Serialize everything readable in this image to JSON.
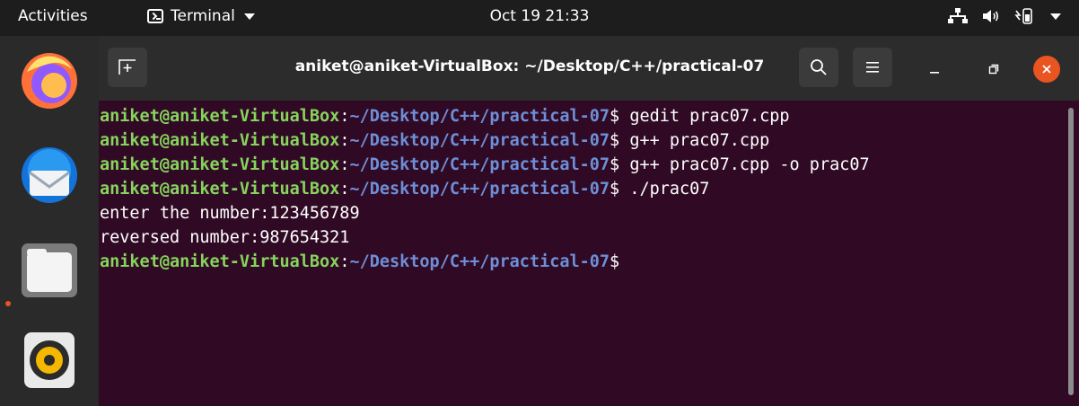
{
  "topbar": {
    "activities": "Activities",
    "app_name": "Terminal",
    "clock": "Oct 19  21:33"
  },
  "dock": {
    "items": [
      "firefox-icon",
      "thunderbird-icon",
      "files-icon",
      "rhythmbox-icon"
    ]
  },
  "window": {
    "title": "aniket@aniket-VirtualBox: ~/Desktop/C++/practical-07"
  },
  "terminal": {
    "prompt_user": "aniket@aniket-VirtualBox",
    "prompt_path": "~/Desktop/C++/practical-07",
    "commands": [
      "gedit prac07.cpp",
      "g++ prac07.cpp",
      "g++ prac07.cpp -o prac07",
      "./prac07"
    ],
    "output": [
      "enter the number:123456789",
      "reversed number:987654321"
    ]
  },
  "colors": {
    "terminal_bg": "#300a24",
    "prompt_user": "#87d45e",
    "prompt_path": "#6e8fd8",
    "close_button": "#e95420"
  }
}
